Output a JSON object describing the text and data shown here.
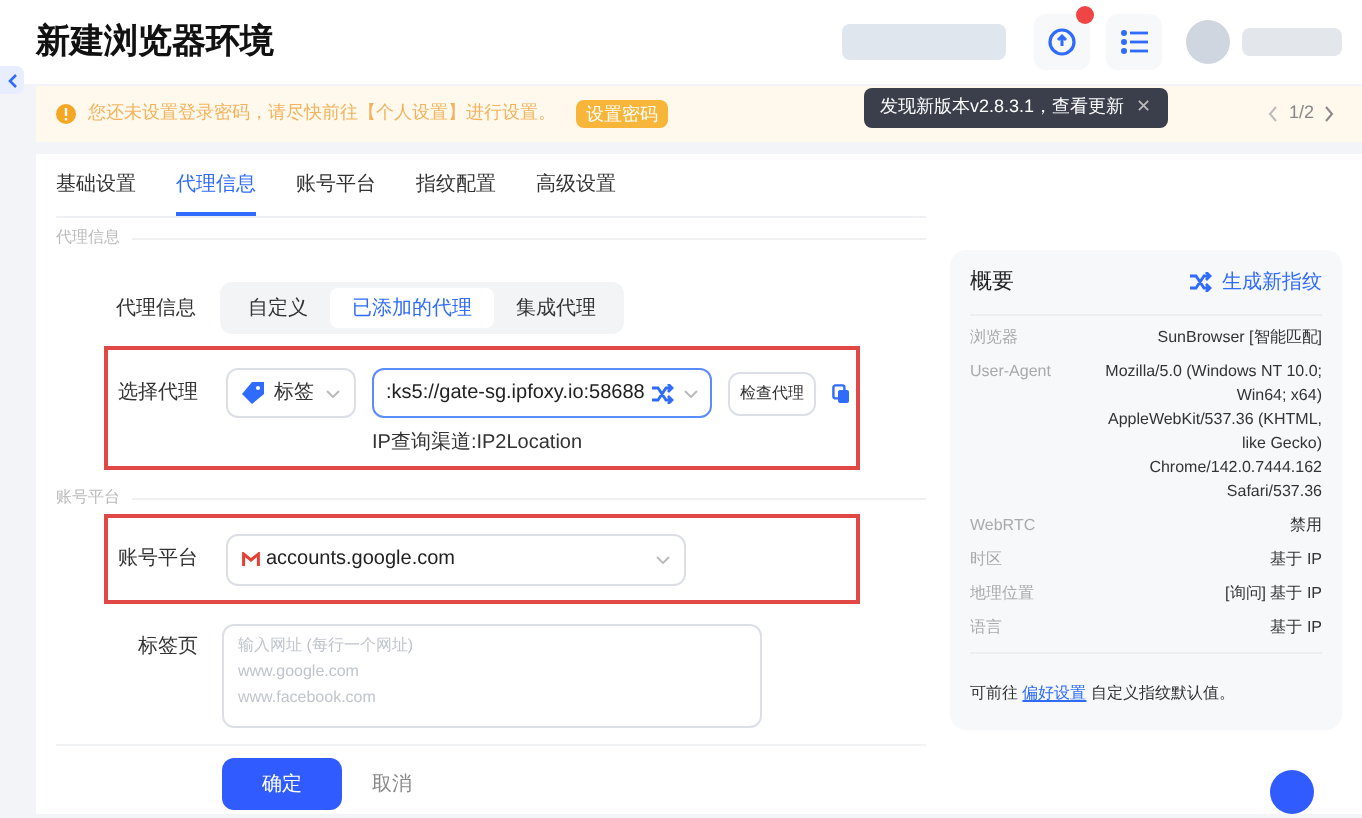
{
  "header": {
    "title": "新建浏览器环境",
    "update_badge": true
  },
  "tooltip": {
    "text": "发现新版本v2.8.3.1，查看更新",
    "close": "✕"
  },
  "notice": {
    "text": "您还未设置登录密码，请尽快前往【个人设置】进行设置。",
    "button": "设置密码",
    "pager": "1/2"
  },
  "tabs": [
    {
      "label": "基础设置",
      "selected": false
    },
    {
      "label": "代理信息",
      "selected": true
    },
    {
      "label": "账号平台",
      "selected": false
    },
    {
      "label": "指纹配置",
      "selected": false
    },
    {
      "label": "高级设置",
      "selected": false
    }
  ],
  "proxy_section": {
    "heading": "代理信息",
    "mode_label": "代理信息",
    "modes": [
      {
        "label": "自定义",
        "selected": false
      },
      {
        "label": "已添加的代理",
        "selected": true
      },
      {
        "label": "集成代理",
        "selected": false
      }
    ],
    "select_label": "选择代理",
    "tag_select": "标签",
    "proxy_value": ":ks5://gate-sg.ipfoxy.io:58688",
    "check_button": "检查代理",
    "ip_channel": "IP查询渠道:IP2Location"
  },
  "account_section": {
    "heading": "账号平台",
    "platform_label": "账号平台",
    "platform_value": "accounts.google.com",
    "tabs_label": "标签页",
    "tabs_placeholder": "输入网址 (每行一个网址)\nwww.google.com\nwww.facebook.com"
  },
  "footer": {
    "confirm": "确定",
    "cancel": "取消"
  },
  "summary": {
    "title": "概要",
    "action": "生成新指纹",
    "rows": [
      {
        "label": "浏览器",
        "value": "SunBrowser [智能匹配]"
      },
      {
        "label": "User-Agent",
        "value": "Mozilla/5.0 (Windows NT 10.0; Win64; x64) AppleWebKit/537.36 (KHTML, like Gecko) Chrome/142.0.7444.162 Safari/537.36"
      },
      {
        "label": "WebRTC",
        "value": "禁用"
      },
      {
        "label": "时区",
        "value": "基于 IP"
      },
      {
        "label": "地理位置",
        "value": "[询问] 基于 IP"
      },
      {
        "label": "语言",
        "value": "基于 IP"
      }
    ],
    "note_before": "可前往",
    "note_link": "偏好设置",
    "note_after": "自定义指纹默认值。"
  }
}
